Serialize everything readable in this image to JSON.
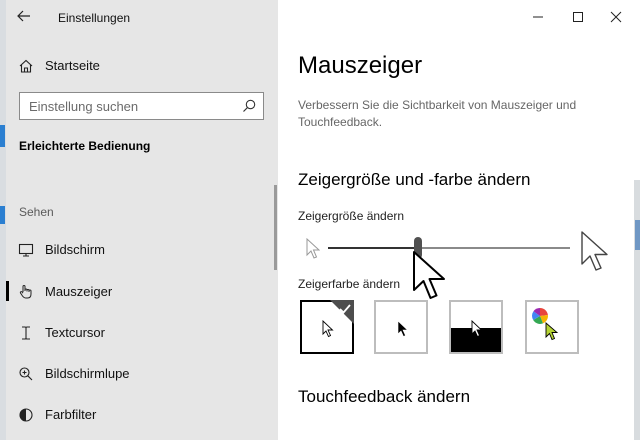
{
  "window": {
    "title": "Einstellungen",
    "controls": [
      "minimize",
      "maximize",
      "close"
    ]
  },
  "sidebar": {
    "home_label": "Startseite",
    "search_placeholder": "Einstellung suchen",
    "section_title": "Erleichterte Bedienung",
    "group_label": "Sehen",
    "items": [
      {
        "label": "Bildschirm",
        "icon": "monitor-icon",
        "selected": false
      },
      {
        "label": "Mauszeiger",
        "icon": "pointer-hand-icon",
        "selected": true
      },
      {
        "label": "Textcursor",
        "icon": "text-cursor-icon",
        "selected": false
      },
      {
        "label": "Bildschirmlupe",
        "icon": "magnifier-icon",
        "selected": false
      },
      {
        "label": "Farbfilter",
        "icon": "color-filter-icon",
        "selected": false
      }
    ]
  },
  "main": {
    "title": "Mauszeiger",
    "description": "Verbessern Sie die Sichtbarkeit von Mauszeiger und Touchfeedback.",
    "size_section_title": "Zeigergröße und -farbe ändern",
    "size_label": "Zeigergröße ändern",
    "size_level": 0.37,
    "color_label": "Zeigerfarbe ändern",
    "color_options": [
      {
        "name": "white",
        "selected": true
      },
      {
        "name": "black",
        "selected": false
      },
      {
        "name": "inverted",
        "selected": false
      },
      {
        "name": "custom",
        "selected": false
      }
    ],
    "touch_section_title": "Touchfeedback ändern"
  },
  "colors": {
    "sidebar_bg": "#e6e6e6",
    "content_bg": "#ffffff",
    "accent": "#000000"
  }
}
